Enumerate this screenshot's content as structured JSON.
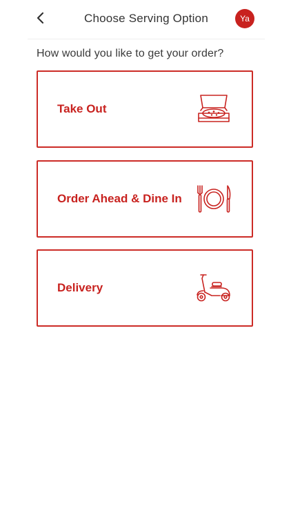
{
  "header": {
    "title": "Choose Serving Option",
    "back_icon": "chevron-left-icon",
    "avatar_initials": "Ya"
  },
  "prompt": "How would you like to get your order?",
  "options": [
    {
      "label": "Take Out",
      "icon": "pizza-box-icon"
    },
    {
      "label": "Order Ahead & Dine In",
      "icon": "plate-cutlery-icon"
    },
    {
      "label": "Delivery",
      "icon": "scooter-icon"
    }
  ],
  "colors": {
    "accent": "#c8221f",
    "text": "#333333",
    "background": "#ffffff"
  }
}
